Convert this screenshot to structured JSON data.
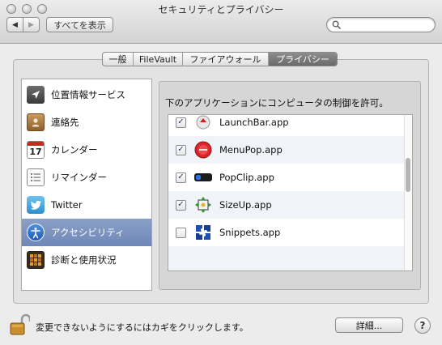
{
  "window": {
    "title": "セキュリティとプライバシー",
    "show_all_label": "すべてを表示",
    "back_glyph": "◀",
    "forward_glyph": "▶",
    "search_placeholder": ""
  },
  "tabs": [
    {
      "label": "一般",
      "active": false
    },
    {
      "label": "FileVault",
      "active": false
    },
    {
      "label": "ファイアウォール",
      "active": false
    },
    {
      "label": "プライバシー",
      "active": true
    }
  ],
  "sidebar": {
    "items": [
      {
        "label": "位置情報サービス",
        "icon": "location-icon"
      },
      {
        "label": "連絡先",
        "icon": "contacts-icon"
      },
      {
        "label": "カレンダー",
        "icon": "calendar-icon",
        "icon_text": "17"
      },
      {
        "label": "リマインダー",
        "icon": "reminders-icon"
      },
      {
        "label": "Twitter",
        "icon": "twitter-icon"
      },
      {
        "label": "アクセシビリティ",
        "icon": "accessibility-icon",
        "selected": true
      },
      {
        "label": "診断と使用状況",
        "icon": "diagnostics-icon"
      }
    ]
  },
  "main": {
    "instruction": "下のアプリケーションにコンピュータの制御を許可。",
    "apps": [
      {
        "name": "LaunchBar.app",
        "checked": true,
        "icon": "launchbar-icon"
      },
      {
        "name": "MenuPop.app",
        "checked": true,
        "icon": "menupop-icon"
      },
      {
        "name": "PopClip.app",
        "checked": true,
        "icon": "popclip-icon"
      },
      {
        "name": "SizeUp.app",
        "checked": true,
        "icon": "sizeup-icon"
      },
      {
        "name": "Snippets.app",
        "checked": false,
        "icon": "snippets-icon"
      }
    ],
    "check_glyph": "✓"
  },
  "footer": {
    "lock_text": "変更できないようにするにはカギをクリックします。",
    "details_label": "詳細...",
    "help_label": "?"
  }
}
